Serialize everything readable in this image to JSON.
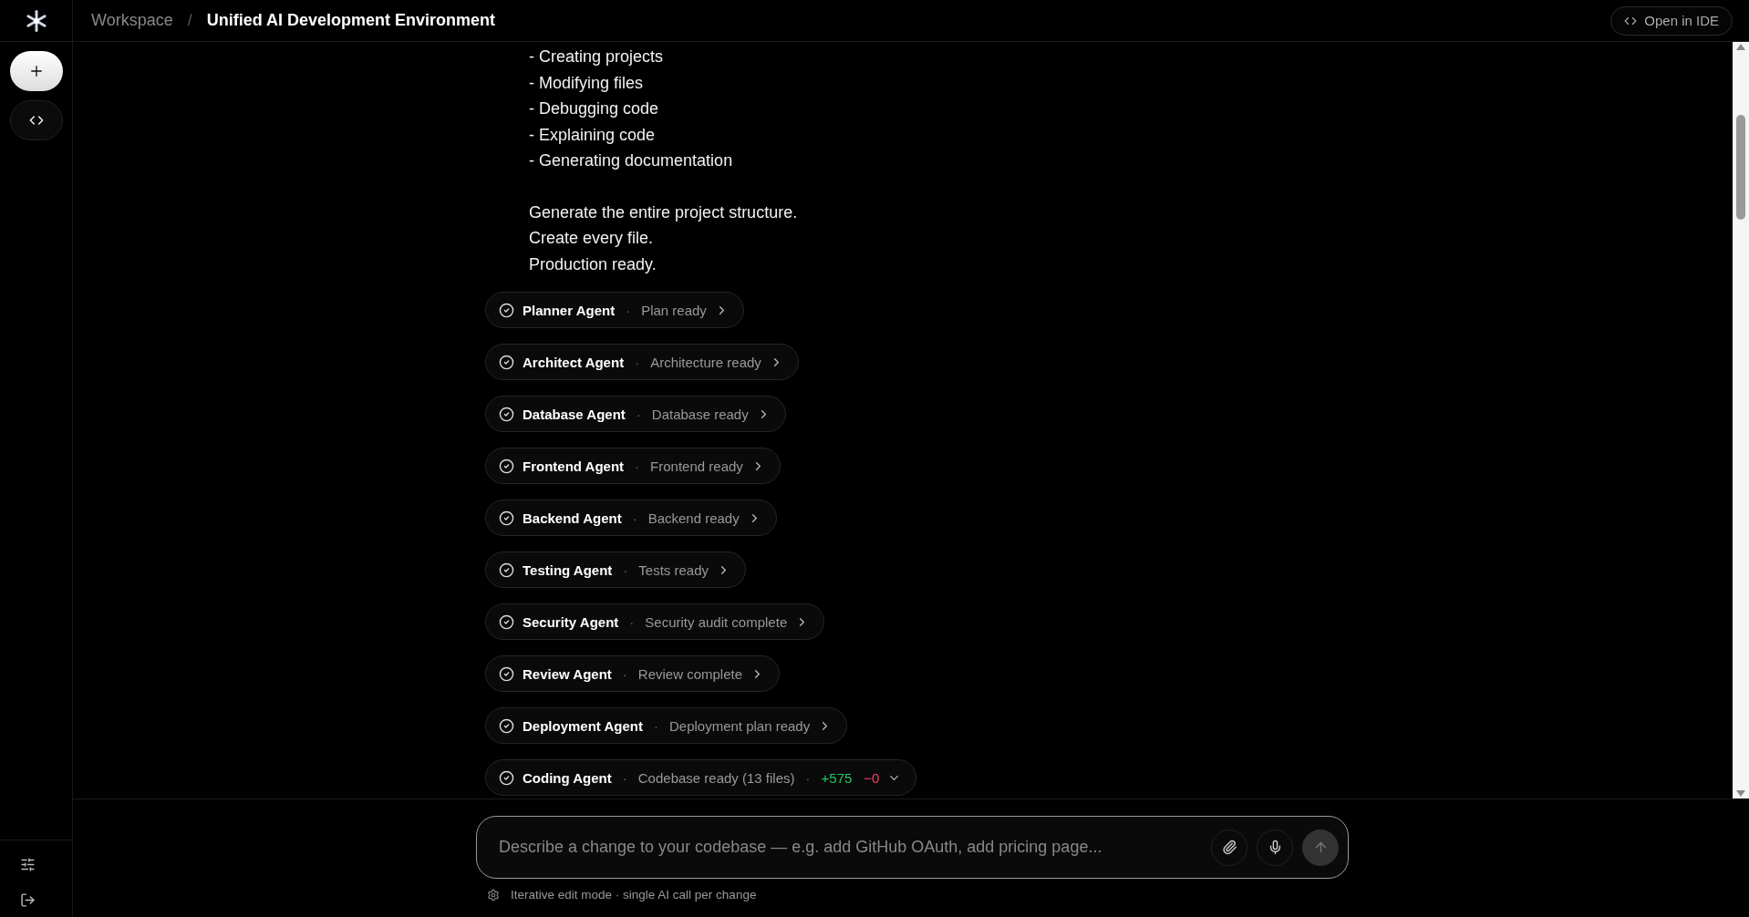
{
  "breadcrumb": {
    "parent": "Workspace",
    "separator": "/",
    "current": "Unified AI Development Environment"
  },
  "header_button": {
    "label": "Open in IDE"
  },
  "message": {
    "bullets": [
      "- Creating projects",
      "- Modifying files",
      "- Debugging code",
      "- Explaining code",
      "- Generating documentation"
    ],
    "closing": [
      "Generate the entire project structure.",
      "Create every file.",
      "Production ready."
    ]
  },
  "agents": [
    {
      "name": "Planner Agent",
      "separator": "·",
      "status": "Plan ready",
      "expanded": false
    },
    {
      "name": "Architect Agent",
      "separator": "·",
      "status": "Architecture ready",
      "expanded": false
    },
    {
      "name": "Database Agent",
      "separator": "·",
      "status": "Database ready",
      "expanded": false
    },
    {
      "name": "Frontend Agent",
      "separator": "·",
      "status": "Frontend ready",
      "expanded": false
    },
    {
      "name": "Backend Agent",
      "separator": "·",
      "status": "Backend ready",
      "expanded": false
    },
    {
      "name": "Testing Agent",
      "separator": "·",
      "status": "Tests ready",
      "expanded": false
    },
    {
      "name": "Security Agent",
      "separator": "·",
      "status": "Security audit complete",
      "expanded": false
    },
    {
      "name": "Review Agent",
      "separator": "·",
      "status": "Review complete",
      "expanded": false
    },
    {
      "name": "Deployment Agent",
      "separator": "·",
      "status": "Deployment plan ready",
      "expanded": false
    },
    {
      "name": "Coding Agent",
      "separator": "·",
      "status": "Codebase ready (13 files)",
      "expanded": false,
      "diff": {
        "separator": "·",
        "additions": "+575",
        "deletions": "−0"
      }
    }
  ],
  "composer": {
    "placeholder": "Describe a change to your codebase — e.g. add GitHub OAuth, add pricing page..."
  },
  "footer_note": "Iterative edit mode · single AI call per change"
}
